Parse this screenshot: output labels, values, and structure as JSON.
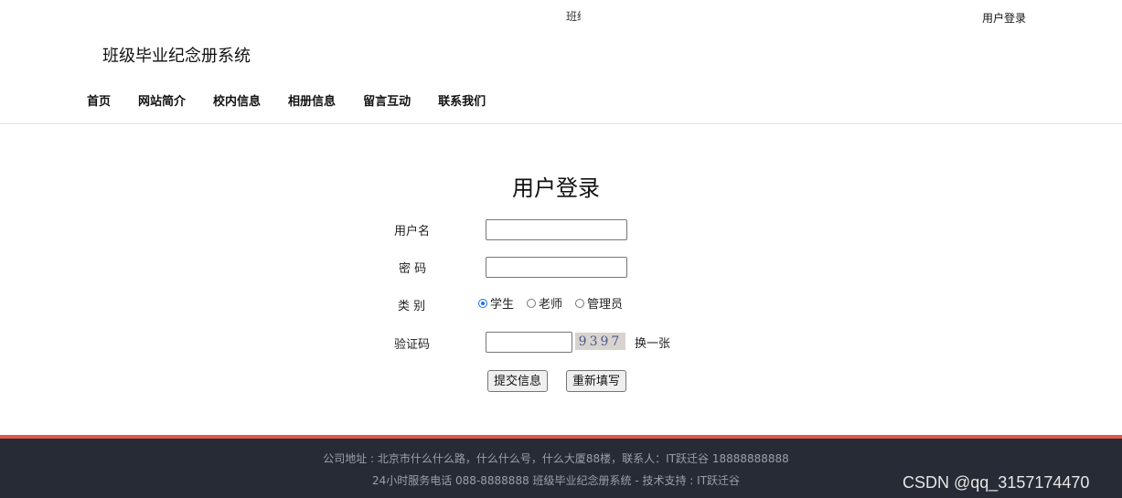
{
  "header": {
    "marquee_text": "班级",
    "login_link": "用户登录",
    "site_title": "班级毕业纪念册系统",
    "nav": [
      "首页",
      "网站简介",
      "校内信息",
      "相册信息",
      "留言互动",
      "联系我们"
    ]
  },
  "form": {
    "title": "用户登录",
    "username_label": "用户名",
    "username_value": "",
    "password_label": "密 码",
    "password_value": "",
    "type_label": "类 别",
    "types": [
      "学生",
      "老师",
      "管理员"
    ],
    "selected_type": "学生",
    "captcha_label": "验证码",
    "captcha_value": "",
    "captcha_image_text": "9397",
    "refresh_label": "换一张",
    "submit_label": "提交信息",
    "reset_label": "重新填写"
  },
  "footer": {
    "line1": "公司地址 : 北京市什么什么路，什么什么号，什么大厦88楼，联系人：IT跃迁谷 18888888888",
    "line2": "24小时服务电话   088-8888888   班级毕业纪念册系统 - 技术支持 : IT跃迁谷",
    "watermark": "CSDN @qq_3157174470",
    "accent_color": "#e1574a",
    "bg_color": "#262b35"
  }
}
